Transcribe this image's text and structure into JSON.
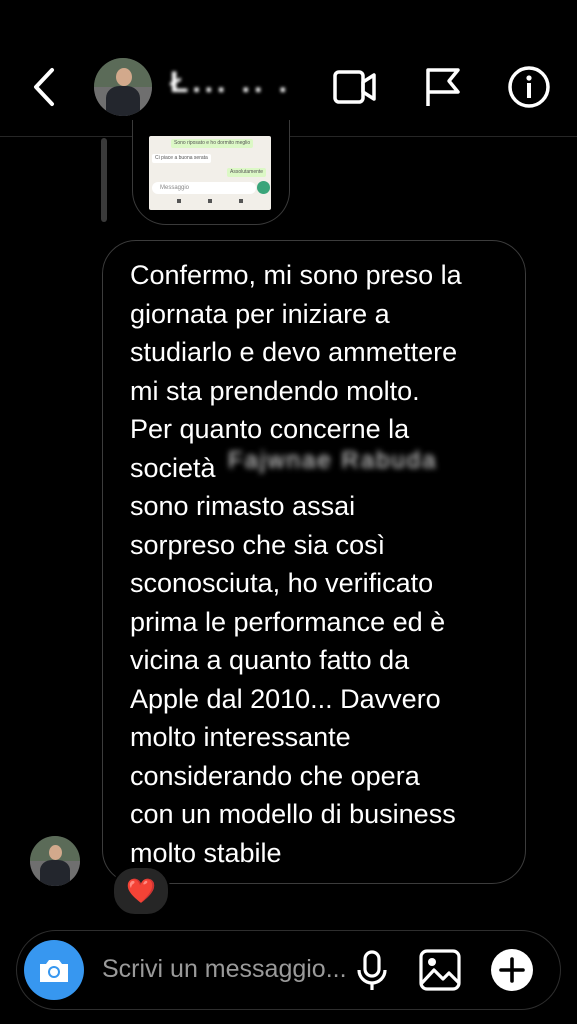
{
  "header": {
    "contact_name": "Ł... .. ."
  },
  "shared_image": {
    "lines": [
      "Sono riposato e ho dormito meglio",
      "Ci piace a buona serata",
      "Assolutamente"
    ],
    "input_placeholder": "Messaggio"
  },
  "message": {
    "text": "Confermo, mi sono preso la\ngiornata per iniziare a\nstudiarlo e devo ammettere\nmi sta prendendo molto.\nPer quanto concerne la\nsocietà\nsono rimasto assai\nsorpreso che sia così\nsconosciuta, ho verificato\nprima le performance ed è\nvicina a quanto fatto da\nApple dal 2010... Davvero\nmolto interessante\nconsiderando che opera\ncon un modello di business\nmolto stabile",
    "redacted": "Fajwnae Rabuda",
    "reaction": "❤️"
  },
  "composer": {
    "placeholder": "Scrivi un messaggio..."
  },
  "icons": {
    "back": "chevron-left-icon",
    "video": "video-camera-icon",
    "flag": "flag-icon",
    "info": "info-icon",
    "camera": "camera-icon",
    "mic": "microphone-icon",
    "gallery": "image-icon",
    "add": "plus-circle-icon"
  },
  "colors": {
    "background": "#000000",
    "accent": "#3797f0",
    "bubble_border": "#3c3c3c"
  }
}
